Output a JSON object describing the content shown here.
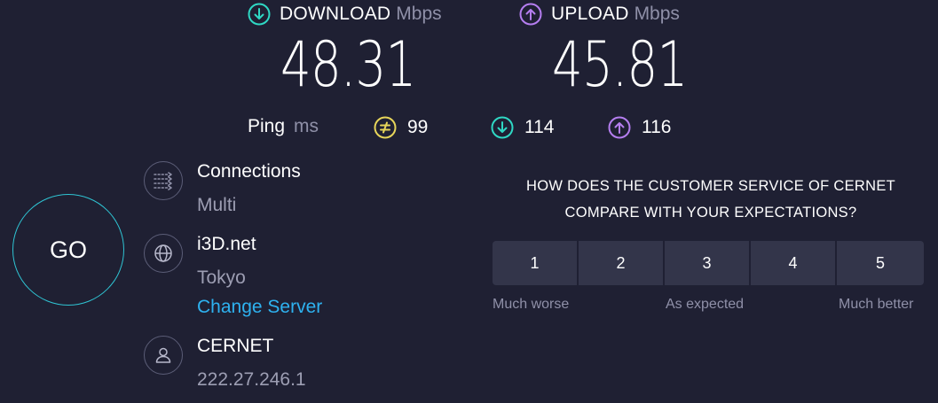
{
  "download": {
    "label": "DOWNLOAD",
    "unit": "Mbps",
    "value": "48.31",
    "icon": "arrow-down-circle-icon",
    "color": "#2fd8c4"
  },
  "upload": {
    "label": "UPLOAD",
    "unit": "Mbps",
    "value": "45.81",
    "icon": "arrow-up-circle-icon",
    "color": "#b57ef0"
  },
  "ping": {
    "label": "Ping",
    "unit": "ms",
    "idle": {
      "value": "99",
      "icon": "idle-latency-icon",
      "color": "#e7d55a"
    },
    "download": {
      "value": "114",
      "icon": "arrow-down-circle-icon",
      "color": "#2fd8c4"
    },
    "upload": {
      "value": "116",
      "icon": "arrow-up-circle-icon",
      "color": "#b57ef0"
    }
  },
  "go_button": {
    "label": "GO",
    "color": "#2fc4d3"
  },
  "connections": {
    "title": "Connections",
    "value": "Multi",
    "icon": "connections-icon"
  },
  "server": {
    "name": "i3D.net",
    "location": "Tokyo",
    "change_label": "Change Server",
    "icon": "globe-icon"
  },
  "provider": {
    "name": "CERNET",
    "ip": "222.27.246.1",
    "icon": "user-icon"
  },
  "survey": {
    "question_line1": "HOW DOES THE CUSTOMER SERVICE OF CERNET",
    "question_line2": "COMPARE WITH YOUR EXPECTATIONS?",
    "ratings": [
      "1",
      "2",
      "3",
      "4",
      "5"
    ],
    "scale_low": "Much worse",
    "scale_mid": "As expected",
    "scale_high": "Much better"
  },
  "colors": {
    "background": "#1f2033",
    "link": "#2eb2f0",
    "muted": "#8f90a8"
  }
}
